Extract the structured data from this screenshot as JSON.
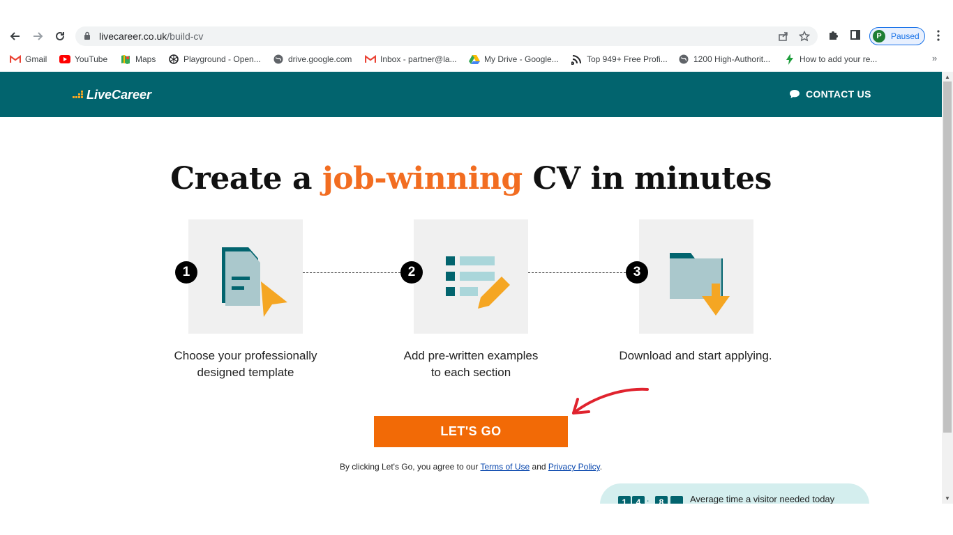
{
  "browser": {
    "url_host": "livecareer.co.uk",
    "url_path": "/build-cv",
    "profile_initial": "P",
    "profile_label": "Paused",
    "bookmarks": [
      {
        "label": "Gmail",
        "icon": "gmail-icon"
      },
      {
        "label": "YouTube",
        "icon": "youtube-icon"
      },
      {
        "label": "Maps",
        "icon": "maps-icon"
      },
      {
        "label": "Playground - Open...",
        "icon": "openai-icon"
      },
      {
        "label": "drive.google.com",
        "icon": "globe-icon"
      },
      {
        "label": "Inbox - partner@la...",
        "icon": "gmail-icon"
      },
      {
        "label": "My Drive - Google...",
        "icon": "google-drive-icon"
      },
      {
        "label": "Top 949+ Free Profi...",
        "icon": "feed-icon"
      },
      {
        "label": "1200 High-Authorit...",
        "icon": "globe-icon"
      },
      {
        "label": "How to add your re...",
        "icon": "bolt-icon"
      }
    ],
    "more_bookmarks": "»"
  },
  "site": {
    "logo_text": "LiveCareer",
    "contact_label": "CONTACT US"
  },
  "hero": {
    "headline_before": "Create a",
    "headline_highlight": "job-winning",
    "headline_after": "CV in minutes"
  },
  "steps": [
    {
      "number": "1",
      "caption_line1": "Choose your professionally",
      "caption_line2": "designed template"
    },
    {
      "number": "2",
      "caption_line1": "Add pre-written examples",
      "caption_line2": "to each section"
    },
    {
      "number": "3",
      "caption_line1": "Download and start applying.",
      "caption_line2": ""
    }
  ],
  "cta": {
    "label": "LET'S GO"
  },
  "terms": {
    "prefix": "By clicking Let's Go, you agree to our",
    "terms_link": "Terms of Use",
    "and": "and",
    "privacy_link": "Privacy Policy",
    "suffix": "."
  },
  "timer": {
    "digits": [
      "1",
      "4",
      "8",
      ""
    ],
    "separator": ":",
    "text": "Average time a visitor needed today"
  },
  "colors": {
    "brand_teal": "#02646e",
    "accent_orange": "#f26a06",
    "annotation_red": "#e0232e"
  }
}
